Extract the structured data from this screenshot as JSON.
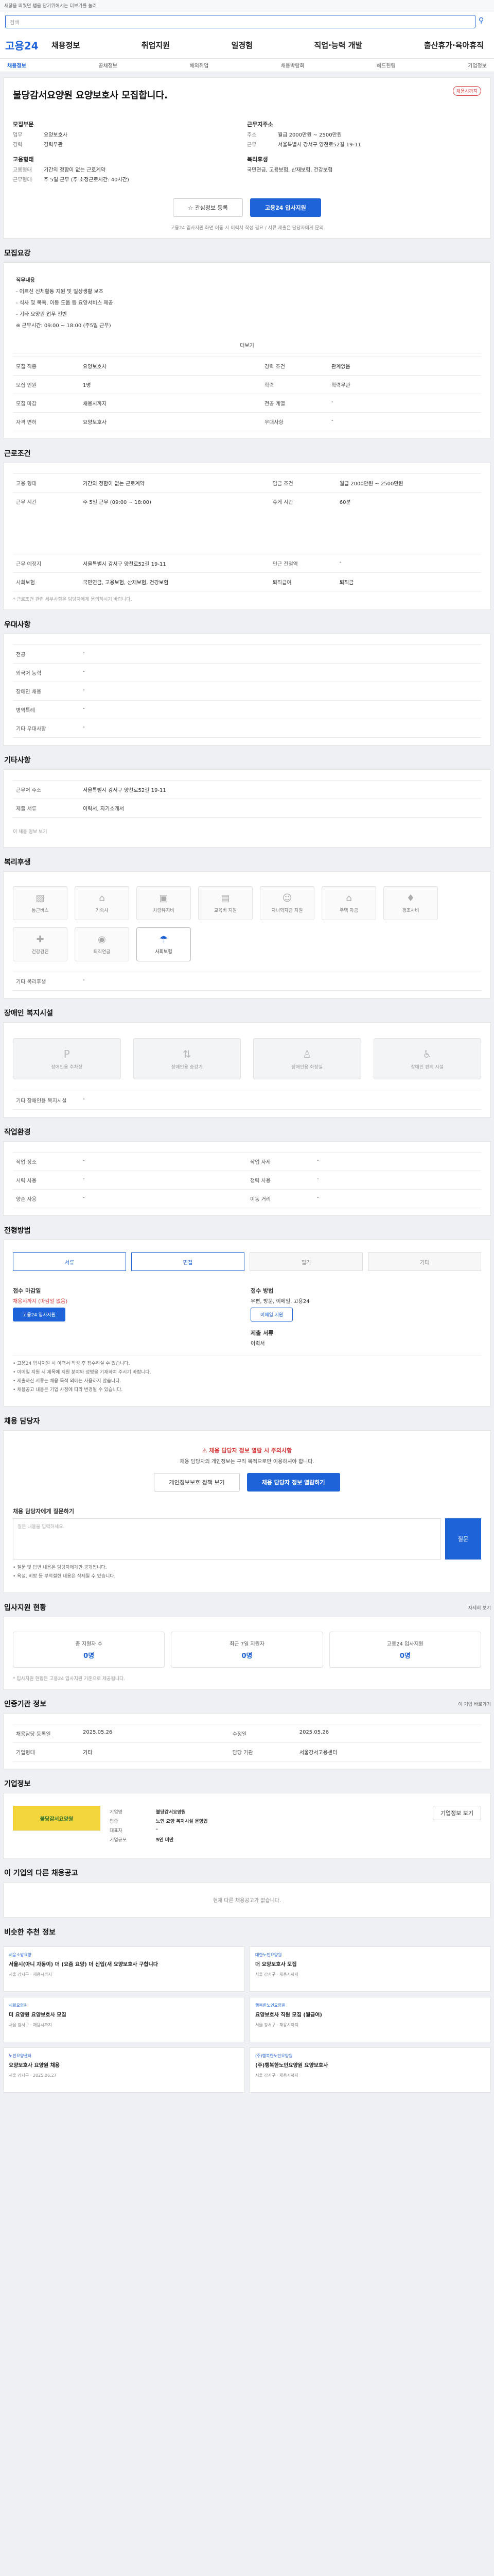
{
  "topbar": {
    "notice": "새창을 띄웠던 탭을 닫기위해서는 더보기를 눌러"
  },
  "search": {
    "placeholder": "검색"
  },
  "header": {
    "logo": "고용24",
    "menu": [
      "채용정보",
      "취업지원",
      "일경험",
      "직업·능력 개발",
      "출산휴가·육아휴직"
    ],
    "util": "로그인 · 회원가입"
  },
  "subnav": {
    "items": [
      "채용정보",
      "공채정보",
      "해외취업",
      "채용박람회",
      "헤드헌팅",
      "기업정보"
    ],
    "active": 0
  },
  "job": {
    "badge": "채용시까지",
    "title": "불당감서요양원 요양보호사 모집합니다.",
    "left_title": "모집부문",
    "left": [
      {
        "k": "업무",
        "v": "요양보호사"
      },
      {
        "k": "경력",
        "v": "경력무관"
      }
    ],
    "right_title": "근무지주소",
    "right": [
      {
        "k": "주소",
        "v": "월급 2000만원 ~ 2500만원"
      },
      {
        "k": "근무",
        "v": "서울특별시 강서구 양천로52길 19-11"
      }
    ],
    "cond_title": "고용형태",
    "cond": [
      {
        "k": "고용형태",
        "v": "기간의 정함이 없는 근로계약"
      },
      {
        "k": "근무형태",
        "v": "주 5일 근무 (주 소정근로시간: 40시간)"
      }
    ],
    "pay_title": "복리후생",
    "pay": "국민연금, 고용보험, 산재보험, 건강보험",
    "btn_scrap": "관심정보 등록",
    "btn_apply": "고용24 입사지원",
    "note": "고용24 입사지원 화면 이동 시 이력서 작성 필요 / 서류 제출은 담당자에게 문의"
  },
  "recruit": {
    "title": "모집요강",
    "para": [
      "직무내용",
      "- 어르신 신체활동 지원 및 일상생활 보조",
      "- 식사 및 목욕, 이동 도움 등 요양서비스 제공",
      "- 기타 요양원 업무 전반",
      "※ 근무시간: 09:00 ~ 18:00 (주5일 근무)"
    ],
    "more": "더보기",
    "rows": [
      [
        "모집 직종",
        "요양보호사",
        "경력 조건",
        "관계없음"
      ],
      [
        "모집 인원",
        "1명",
        "학력",
        "학력무관"
      ],
      [
        "모집 마감",
        "채용시까지",
        "전공 계열",
        "-"
      ],
      [
        "자격 면허",
        "요양보호사",
        "우대사항",
        "-"
      ]
    ]
  },
  "work": {
    "title": "근로조건",
    "rows": [
      [
        "고용 형태",
        "기간의 정함이 없는 근로계약",
        "임금 조건",
        "월급 2000만원 ~ 2500만원"
      ],
      [
        "근무 시간",
        "주 5일 근무 (09:00 ~ 18:00)",
        "휴게 시간",
        "60분"
      ],
      [
        "근무 예정지",
        "서울특별시 강서구 양천로52길 19-11",
        "인근 전철역",
        "-"
      ],
      [
        "사회보험",
        "국민연금, 고용보험, 산재보험, 건강보험",
        "퇴직급여",
        "퇴직금"
      ]
    ],
    "note": "* 근로조건 관련 세부사항은 담당자에게 문의하시기 바랍니다."
  },
  "prefer": {
    "title": "우대사항",
    "rows": [
      [
        "전공",
        "-"
      ],
      [
        "외국어 능력",
        "-"
      ],
      [
        "장애인 채용",
        "-"
      ],
      [
        "병역특례",
        "-"
      ],
      [
        "기타 우대사항",
        "-"
      ]
    ]
  },
  "extra": {
    "title": "기타사항",
    "rows": [
      [
        "근무처 주소",
        "서울특별시 강서구 양천로52길 19-11"
      ],
      [
        "제출 서류",
        "이력서, 자기소개서"
      ]
    ],
    "link": "이 채용 정보 보기"
  },
  "welfare": {
    "title": "복리후생",
    "items": [
      "통근버스",
      "기숙사",
      "차량유지비",
      "교육비 지원",
      "자녀학자금 지원",
      "주택 자금",
      "경조사비",
      "건강검진",
      "퇴직연금",
      "사회보험"
    ],
    "on": [
      9
    ],
    "extra_label": "기타 복리후생",
    "extra_val": "-"
  },
  "disabled": {
    "title": "장애인 복지시설",
    "steps": [
      "장애인용 주차장",
      "장애인용 승강기",
      "장애인용 화장실",
      "장애인 편의 시설"
    ],
    "label": "기타 장애인용 복지시설",
    "val": "-"
  },
  "env": {
    "title": "작업환경",
    "rows": [
      [
        "작업 장소",
        "-",
        "작업 자세",
        "-"
      ],
      [
        "시력 사용",
        "-",
        "청력 사용",
        "-"
      ],
      [
        "양손 사용",
        "-",
        "이동 거리",
        "-"
      ]
    ]
  },
  "apply": {
    "title": "전형방법",
    "tabs": [
      "서류",
      "면접",
      "필기",
      "기타"
    ],
    "method_label": "접수 마감일",
    "method": "채용시까지 (마감일 없음)",
    "btn1": "고용24 입사지원",
    "doc_label": "접수 방법",
    "doc": "우편, 방문, 이메일, 고용24",
    "btn2": "이메일 지원",
    "submit_label": "제출 서류",
    "submit": "이력서",
    "bullets": [
      "• 고용24 입사지원 시 이력서 작성 후 접수하실 수 있습니다.",
      "• 이메일 지원 시 제목에 지원 분야와 성명을 기재하여 주시기 바랍니다.",
      "• 제출하신 서류는 채용 목적 외에는 사용하지 않습니다.",
      "• 채용공고 내용은 기업 사정에 따라 변경될 수 있습니다."
    ]
  },
  "contact": {
    "title": "채용 담당자",
    "warn": "채용 담당자 정보 열람 시 주의사항",
    "warn_text": "채용 담당자의 개인정보는 구직 목적으로만 이용하셔야 합니다.",
    "btn1": "개인정보보호 정책 보기",
    "btn2": "채용 담당자 정보 열람하기",
    "qa_label": "채용 담당자에게 질문하기",
    "qa_placeholder": "질문 내용을 입력하세요.",
    "qa_btn": "질문",
    "qa_bullets": [
      "• 질문 및 답변 내용은 담당자에게만 공개됩니다.",
      "• 욕설, 비방 등 부적절한 내용은 삭제될 수 있습니다."
    ]
  },
  "stats": {
    "title": "입사지원 현황",
    "link": "자세히 보기",
    "items": [
      {
        "label": "총 지원자 수",
        "val": "0명"
      },
      {
        "label": "최근 7일 지원자",
        "val": "0명"
      },
      {
        "label": "고용24 입사지원",
        "val": "0명"
      }
    ],
    "note": "* 입사지원 현황은 고용24 입사지원 기준으로 제공됩니다."
  },
  "manage": {
    "title": "인증기관 정보",
    "link": "이 기업 바로가기",
    "rows": [
      [
        "채용담당 등록일",
        "2025.05.26",
        "수정일",
        "2025.05.26"
      ],
      [
        "기업형태",
        "기타",
        "담당 기관",
        "서울강서고용센터"
      ]
    ]
  },
  "company": {
    "title": "기업정보",
    "logo": "불당감서요양원",
    "rows": [
      [
        "기업명",
        "불당감서요양원"
      ],
      [
        "업종",
        "노인 요양 복지시설 운영업"
      ],
      [
        "대표자",
        "-"
      ],
      [
        "기업규모",
        "5인 미만"
      ]
    ],
    "btn": "기업정보 보기"
  },
  "related": {
    "title": "이 기업의 다른 채용공고",
    "note": "현재 다른 채용공고가 없습니다."
  },
  "recommend": {
    "title": "비슷한 추천 정보",
    "items": [
      {
        "co": "세웅소방요양",
        "t": "서울시(아니 자동이) 더 (요즘 요양) 더 신입(새 요양보호사 구합니다",
        "m": "서울 강서구 · 채용시까지"
      },
      {
        "co": "대한노인요양원",
        "t": "더 요양보호사 모집",
        "m": "서울 강서구 · 채용시까지"
      },
      {
        "co": "세화요양원",
        "t": "더 요양원 요양보호사 모집",
        "m": "서울 강서구 · 채용시까지"
      },
      {
        "co": "행복한노인요양원",
        "t": "요양보호사 직원 모집 (월급여)",
        "m": "서울 강서구 · 채용시까지"
      },
      {
        "co": "노인요양센터",
        "t": "요양보호사 요양원 채용",
        "m": "서울 강서구 · 2025.06.27"
      },
      {
        "co": "(주)행복한노인요양원",
        "t": "(주)행복한노인요양원 요양보호사",
        "m": "서울 강서구 · 채용시까지"
      }
    ]
  }
}
